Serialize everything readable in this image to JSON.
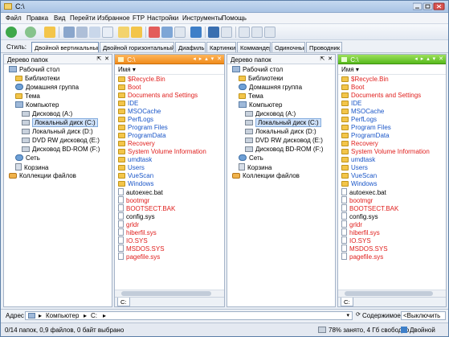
{
  "window": {
    "title": "C:\\"
  },
  "menu": [
    "Файл",
    "Правка",
    "Вид",
    "Перейти",
    "Избранное",
    "FTP",
    "Настройки",
    "Инструменты",
    "Помощь"
  ],
  "toolbar": {
    "icons": [
      "back-icon",
      "forward-icon",
      "up-folder-icon",
      "cut-icon",
      "copy-icon",
      "paste-icon",
      "new-folder-icon",
      "folder-icon",
      "delete-icon",
      "rename-icon",
      "properties-icon",
      "view-mode-icon",
      "layout-icon",
      "pane-icon",
      "pane-alt-icon",
      "details-icon",
      "list-icon",
      "edit-icon"
    ]
  },
  "stylebar": {
    "label": "Стиль:",
    "tabs": [
      "Двойной вертикальный",
      "Двойной горизонтальный",
      "Диафильм",
      "Картинки",
      "Коммандер",
      "Одиночный",
      "Проводник"
    ]
  },
  "left_tree": {
    "header": "Дерево папок",
    "items": [
      {
        "label": "Рабочий стол",
        "icon": "desktop-icon"
      },
      {
        "label": "Библиотеки",
        "icon": "folder-icon"
      },
      {
        "label": "Домашняя группа",
        "icon": "homegroup-icon"
      },
      {
        "label": "Тема",
        "icon": "folder-icon"
      },
      {
        "label": "Компьютер",
        "icon": "computer-icon"
      },
      {
        "label": "Дисковод (A:)",
        "icon": "drive-icon"
      },
      {
        "label": "Локальный диск (C:)",
        "icon": "drive-icon"
      },
      {
        "label": "Локальный диск (D:)",
        "icon": "drive-icon"
      },
      {
        "label": "DVD RW дисковод (E:)",
        "icon": "drive-icon"
      },
      {
        "label": "Дисковод BD-ROM (F:)",
        "icon": "drive-icon"
      },
      {
        "label": "Сеть",
        "icon": "network-icon"
      },
      {
        "label": "Корзина",
        "icon": "recycle-bin-icon"
      },
      {
        "label": "Коллекции файлов",
        "icon": "collections-icon"
      }
    ]
  },
  "right_tree": {
    "header": "Дерево папок",
    "items": [
      {
        "label": "Рабочий стол",
        "icon": "desktop-icon"
      },
      {
        "label": "Библиотеки",
        "icon": "folder-icon"
      },
      {
        "label": "Домашняя группа",
        "icon": "homegroup-icon"
      },
      {
        "label": "Тема",
        "icon": "folder-icon"
      },
      {
        "label": "Компьютер",
        "icon": "computer-icon"
      },
      {
        "label": "Дисковод (A:)",
        "icon": "drive-icon"
      },
      {
        "label": "Локальный диск (C:)",
        "icon": "drive-icon"
      },
      {
        "label": "Локальный диск (D:)",
        "icon": "drive-icon"
      },
      {
        "label": "DVD RW дисковод (E:)",
        "icon": "drive-icon"
      },
      {
        "label": "Дисковод BD-ROM (F:)",
        "icon": "drive-icon"
      },
      {
        "label": "Сеть",
        "icon": "network-icon"
      },
      {
        "label": "Корзина",
        "icon": "recycle-bin-icon"
      },
      {
        "label": "Коллекции файлов",
        "icon": "collections-icon"
      }
    ]
  },
  "list_left": {
    "path": "C:\\",
    "column": "Имя",
    "tab": "C:",
    "items": [
      {
        "name": "$Recycle.Bin",
        "type": "folder",
        "color": "#e0201e"
      },
      {
        "name": "Boot",
        "type": "folder",
        "color": "#e0201e"
      },
      {
        "name": "Documents and Settings",
        "type": "folder",
        "color": "#e0201e"
      },
      {
        "name": "IDE",
        "type": "folder",
        "color": "#1a56c8"
      },
      {
        "name": "MSOCache",
        "type": "folder",
        "color": "#1a56c8"
      },
      {
        "name": "PerfLogs",
        "type": "folder",
        "color": "#1a56c8"
      },
      {
        "name": "Program Files",
        "type": "folder",
        "color": "#1a56c8"
      },
      {
        "name": "ProgramData",
        "type": "folder",
        "color": "#1a56c8"
      },
      {
        "name": "Recovery",
        "type": "folder",
        "color": "#e0201e"
      },
      {
        "name": "System Volume Information",
        "type": "folder",
        "color": "#e0201e"
      },
      {
        "name": "umdtask",
        "type": "folder",
        "color": "#1a56c8"
      },
      {
        "name": "Users",
        "type": "folder",
        "color": "#1a56c8"
      },
      {
        "name": "VueScan",
        "type": "folder",
        "color": "#1a56c8"
      },
      {
        "name": "Windows",
        "type": "folder",
        "color": "#1a56c8"
      },
      {
        "name": "autoexec.bat",
        "type": "file",
        "color": "#000000"
      },
      {
        "name": "bootmgr",
        "type": "file",
        "color": "#e0201e"
      },
      {
        "name": "BOOTSECT.BAK",
        "type": "file",
        "color": "#e0201e"
      },
      {
        "name": "config.sys",
        "type": "file",
        "color": "#000000"
      },
      {
        "name": "grldr",
        "type": "file",
        "color": "#e0201e"
      },
      {
        "name": "hiberfil.sys",
        "type": "file",
        "color": "#e0201e"
      },
      {
        "name": "IO.SYS",
        "type": "file",
        "color": "#e0201e"
      },
      {
        "name": "MSDOS.SYS",
        "type": "file",
        "color": "#e0201e"
      },
      {
        "name": "pagefile.sys",
        "type": "file",
        "color": "#e0201e"
      }
    ]
  },
  "list_right": {
    "path": "C:\\",
    "column": "Имя",
    "tab": "C:",
    "items": [
      {
        "name": "$Recycle.Bin",
        "type": "folder",
        "color": "#e0201e"
      },
      {
        "name": "Boot",
        "type": "folder",
        "color": "#e0201e"
      },
      {
        "name": "Documents and Settings",
        "type": "folder",
        "color": "#e0201e"
      },
      {
        "name": "IDE",
        "type": "folder",
        "color": "#1a56c8"
      },
      {
        "name": "MSOCache",
        "type": "folder",
        "color": "#1a56c8"
      },
      {
        "name": "PerfLogs",
        "type": "folder",
        "color": "#1a56c8"
      },
      {
        "name": "Program Files",
        "type": "folder",
        "color": "#1a56c8"
      },
      {
        "name": "ProgramData",
        "type": "folder",
        "color": "#1a56c8"
      },
      {
        "name": "Recovery",
        "type": "folder",
        "color": "#e0201e"
      },
      {
        "name": "System Volume Information",
        "type": "folder",
        "color": "#e0201e"
      },
      {
        "name": "umdtask",
        "type": "folder",
        "color": "#1a56c8"
      },
      {
        "name": "Users",
        "type": "folder",
        "color": "#1a56c8"
      },
      {
        "name": "VueScan",
        "type": "folder",
        "color": "#1a56c8"
      },
      {
        "name": "Windows",
        "type": "folder",
        "color": "#1a56c8"
      },
      {
        "name": "autoexec.bat",
        "type": "file",
        "color": "#000000"
      },
      {
        "name": "bootmgr",
        "type": "file",
        "color": "#e0201e"
      },
      {
        "name": "BOOTSECT.BAK",
        "type": "file",
        "color": "#e0201e"
      },
      {
        "name": "config.sys",
        "type": "file",
        "color": "#000000"
      },
      {
        "name": "grldr",
        "type": "file",
        "color": "#e0201e"
      },
      {
        "name": "hiberfil.sys",
        "type": "file",
        "color": "#e0201e"
      },
      {
        "name": "IO.SYS",
        "type": "file",
        "color": "#e0201e"
      },
      {
        "name": "MSDOS.SYS",
        "type": "file",
        "color": "#e0201e"
      },
      {
        "name": "pagefile.sys",
        "type": "file",
        "color": "#e0201e"
      }
    ]
  },
  "addressbar": {
    "label": "Адрес",
    "path_parts": [
      "Компьютер",
      "C:"
    ],
    "search_label": "Содержимое",
    "search_value": "<Выключить"
  },
  "statusbar": {
    "left": "0/14 папок, 0,9 файлов, 0 байт выбрано",
    "disk": "78% занято, 4 Гб свободно",
    "mode": "Двойной"
  },
  "colors": {
    "accent_orange": "#f08b1c",
    "accent_green": "#56b91c",
    "folder_red": "#e0201e",
    "folder_blue": "#1a56c8"
  }
}
